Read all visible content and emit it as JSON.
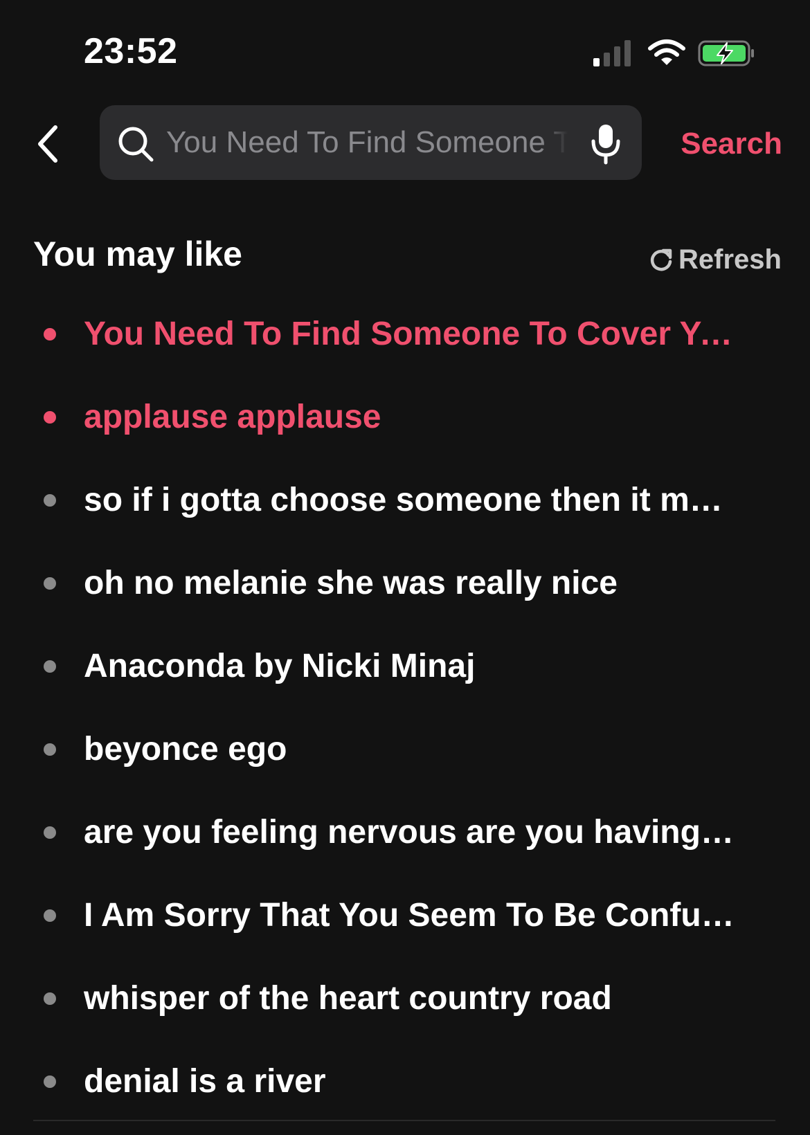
{
  "status_bar": {
    "time": "23:52",
    "icons": [
      "signal-icon",
      "wifi-icon",
      "battery-charging-icon"
    ],
    "battery_color": "#4cd964"
  },
  "header": {
    "back_icon": "chevron-left-icon",
    "search_placeholder": "You Need To Find Someone To Cover Your Shift",
    "search_placeholder_visible": "You Need To Find Someone.",
    "search_button_label": "Search",
    "accent_color": "#f0506e"
  },
  "suggestions": {
    "title": "You may like",
    "refresh_label": "Refresh",
    "items": [
      {
        "text": "You Need To Find Someone To Cover Yo...",
        "hot": true
      },
      {
        "text": "applause applause",
        "hot": true
      },
      {
        "text": "so if i gotta choose someone then it mu...",
        "hot": false
      },
      {
        "text": "oh no melanie she was really nice",
        "hot": false
      },
      {
        "text": "Anaconda by Nicki Minaj",
        "hot": false
      },
      {
        "text": "beyonce ego",
        "hot": false
      },
      {
        "text": "are you feeling nervous are you having f...",
        "hot": false
      },
      {
        "text": "I Am Sorry That You Seem To Be Confus...",
        "hot": false
      },
      {
        "text": "whisper of the heart country road",
        "hot": false
      },
      {
        "text": "denial is a river",
        "hot": false
      }
    ]
  }
}
